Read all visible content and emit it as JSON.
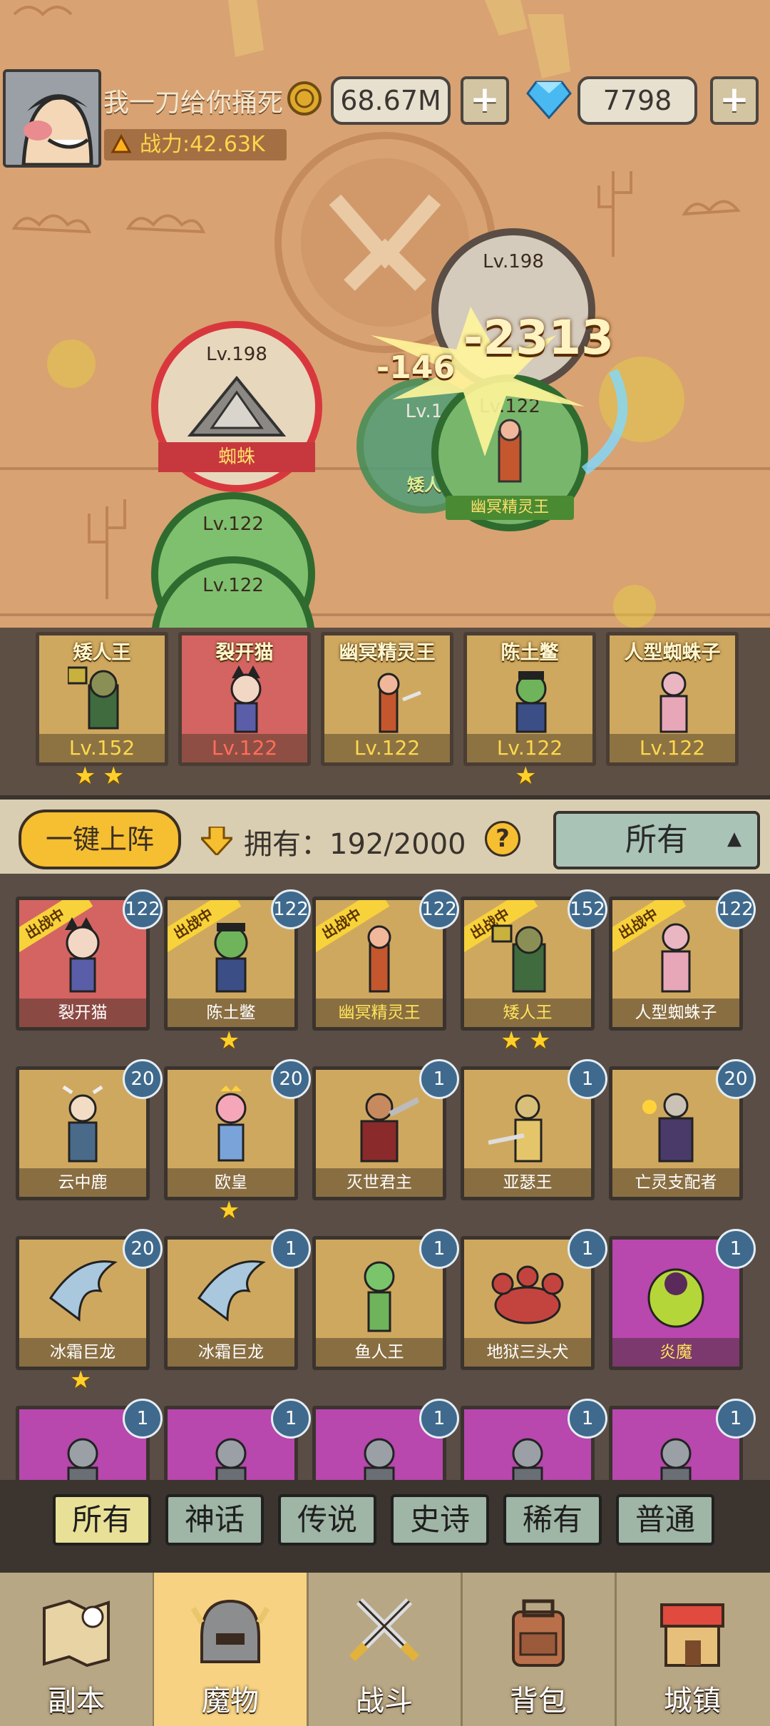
{
  "player": {
    "name": "我一刀给你捅死",
    "power_label": "战力:42.63K",
    "gold": "68.67M",
    "gems": "7798",
    "plus": "+"
  },
  "battle": {
    "damage_main": "-2313",
    "damage_side": "-146",
    "units": [
      {
        "level": "Lv.198",
        "name": "蜘蛛"
      },
      {
        "level": "Lv.198",
        "name": ""
      },
      {
        "level": "Lv.122",
        "name": "幽冥精灵王"
      },
      {
        "level": "Lv.1",
        "name": "矮人"
      },
      {
        "level": "Lv.122",
        "name": ""
      },
      {
        "level": "Lv.122",
        "name": ""
      }
    ]
  },
  "team": [
    {
      "name": "矮人王",
      "level": "Lv.152"
    },
    {
      "name": "裂开猫",
      "level": "Lv.122"
    },
    {
      "name": "幽冥精灵王",
      "level": "Lv.122"
    },
    {
      "name": "陈土鳖",
      "level": "Lv.122"
    },
    {
      "name": "人型蜘蛛子",
      "level": "Lv.122"
    }
  ],
  "controls": {
    "deploy": "一键上阵",
    "own_label": "拥有：192/2000",
    "help": "?",
    "filter": "所有"
  },
  "deployed_tag": "出战中",
  "monsters": [
    {
      "name": "裂开猫",
      "level": "122"
    },
    {
      "name": "陈土鳖",
      "level": "122"
    },
    {
      "name": "幽冥精灵王",
      "level": "122"
    },
    {
      "name": "矮人王",
      "level": "152"
    },
    {
      "name": "人型蜘蛛子",
      "level": "122"
    },
    {
      "name": "云中鹿",
      "level": "20"
    },
    {
      "name": "欧皇",
      "level": "20"
    },
    {
      "name": "灭世君主",
      "level": "1"
    },
    {
      "name": "亚瑟王",
      "level": "1"
    },
    {
      "name": "亡灵支配者",
      "level": "20"
    },
    {
      "name": "冰霜巨龙",
      "level": "20"
    },
    {
      "name": "冰霜巨龙",
      "level": "1"
    },
    {
      "name": "鱼人王",
      "level": "1"
    },
    {
      "name": "地狱三头犬",
      "level": "1"
    },
    {
      "name": "炎魔",
      "level": "1"
    },
    {
      "name": "",
      "level": "1"
    },
    {
      "name": "",
      "level": "1"
    },
    {
      "name": "",
      "level": "1"
    },
    {
      "name": "",
      "level": "1"
    },
    {
      "name": "",
      "level": "1"
    }
  ],
  "rarity_tabs": [
    "所有",
    "神话",
    "传说",
    "史诗",
    "稀有",
    "普通"
  ],
  "nav": [
    "副本",
    "魔物",
    "战斗",
    "背包",
    "城镇"
  ],
  "colors": {
    "accent": "#f6be31",
    "level_badge": "#3f6a8d",
    "rare_purple": "#b847ae"
  }
}
